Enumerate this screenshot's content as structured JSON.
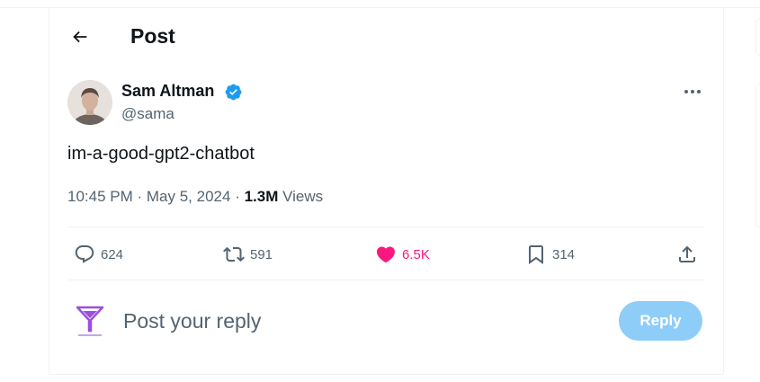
{
  "header": {
    "title": "Post"
  },
  "author": {
    "name": "Sam Altman",
    "handle": "@sama",
    "verified": true
  },
  "tweet": {
    "text": "im-a-good-gpt2-chatbot",
    "time": "10:45 PM",
    "date": "May 5, 2024",
    "views_count": "1.3M",
    "views_label": "Views"
  },
  "actions": {
    "replies": "624",
    "reposts": "591",
    "likes": "6.5K",
    "bookmarks": "314"
  },
  "composer": {
    "placeholder": "Post your reply",
    "button_label": "Reply"
  },
  "icons": {
    "back": "arrow-left-icon",
    "verified": "verified-badge-icon",
    "more": "more-horizontal-icon",
    "reply": "reply-icon",
    "repost": "repost-icon",
    "like": "heart-icon",
    "bookmark": "bookmark-icon",
    "share": "share-icon"
  },
  "colors": {
    "accent": "#1d9bf0",
    "like": "#f91880",
    "reply_button": "#8ecdf8",
    "logo": "#9d4edd"
  }
}
